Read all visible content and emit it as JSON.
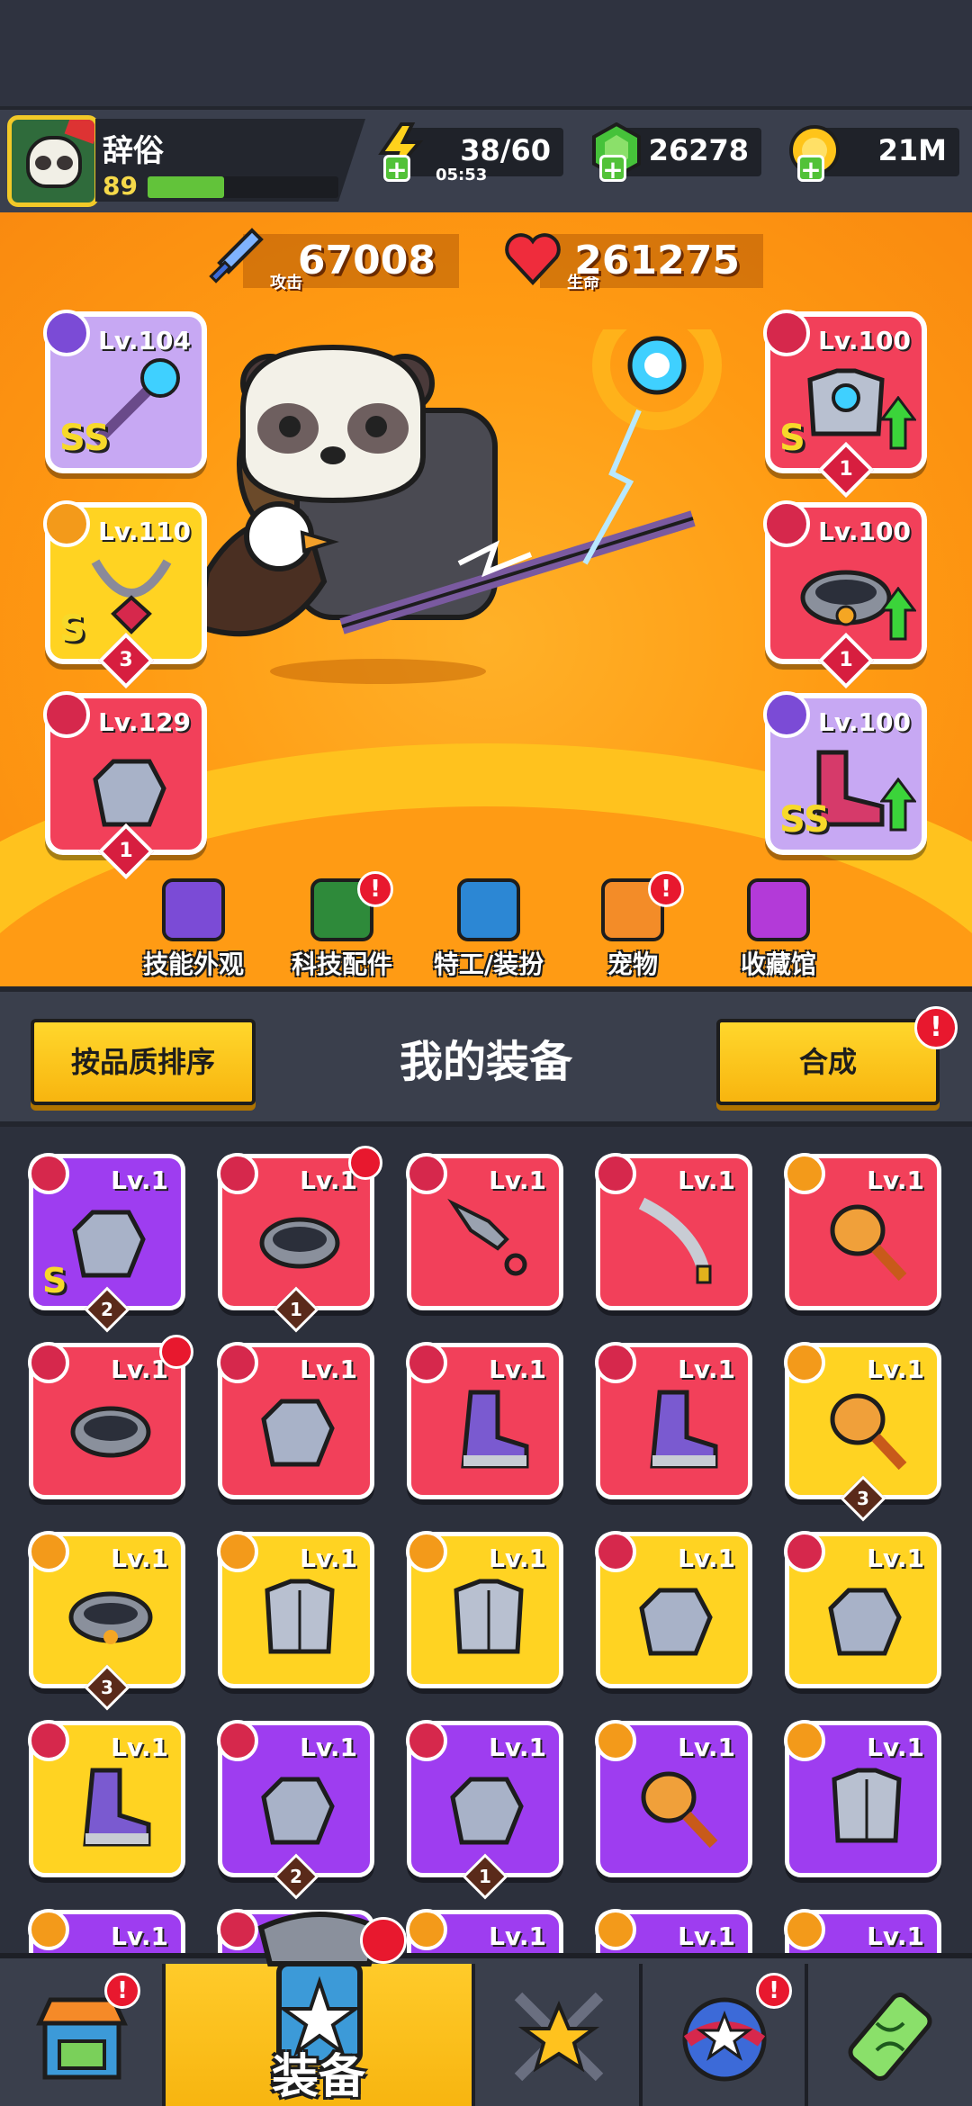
{
  "player": {
    "name": "辞俗",
    "level": "89",
    "xp_fraction": 0.4
  },
  "resources": {
    "energy": {
      "value": "38/60",
      "timer": "05:53",
      "icon": "lightning-icon"
    },
    "gems": {
      "value": "26278",
      "icon": "green-gem-icon"
    },
    "coins": {
      "value": "21M",
      "icon": "gold-coin-icon"
    }
  },
  "stats": {
    "attack": {
      "label": "攻击",
      "value": "67008",
      "icon": "sword-icon"
    },
    "health": {
      "label": "生命",
      "value": "261275",
      "icon": "heart-icon"
    }
  },
  "equipped": {
    "left": [
      {
        "level": "Lv.104",
        "rank": "SS",
        "stars": "",
        "color": "#c7a8f3",
        "item": "staff"
      },
      {
        "level": "Lv.110",
        "rank": "S",
        "stars": "3",
        "color": "#ffd322",
        "item": "necklace"
      },
      {
        "level": "Lv.129",
        "rank": "",
        "stars": "1",
        "color": "#f2405a",
        "item": "glove"
      }
    ],
    "right": [
      {
        "level": "Lv.100",
        "rank": "S",
        "stars": "1",
        "color": "#f2405a",
        "item": "armor",
        "upgrade": true
      },
      {
        "level": "Lv.100",
        "rank": "",
        "stars": "1",
        "color": "#f2405a",
        "item": "belt",
        "upgrade": true
      },
      {
        "level": "Lv.100",
        "rank": "SS",
        "stars": "",
        "color": "#c7a8f3",
        "item": "boots",
        "upgrade": true
      }
    ]
  },
  "shortcuts": [
    {
      "label": "技能外观",
      "alert": false,
      "color": "#7b4bd6"
    },
    {
      "label": "科技配件",
      "alert": true,
      "color": "#2e8a3a"
    },
    {
      "label": "特工/装扮",
      "alert": false,
      "color": "#2c87d4"
    },
    {
      "label": "宠物",
      "alert": true,
      "color": "#f38c28"
    },
    {
      "label": "收藏馆",
      "alert": false,
      "color": "#b33ad8"
    }
  ],
  "equipment_header": {
    "sort_button": "按品质排序",
    "title": "我的装备",
    "merge_button": "合成",
    "merge_alert": "!"
  },
  "inventory": [
    {
      "level": "Lv.1",
      "color": "#9e3df0",
      "rank": "S",
      "count": "2",
      "item": "glove",
      "badge": false
    },
    {
      "level": "Lv.1",
      "color": "#f2405a",
      "rank": "",
      "count": "1",
      "item": "ring",
      "badge": true
    },
    {
      "level": "Lv.1",
      "color": "#f2405a",
      "rank": "",
      "count": "",
      "item": "kunai",
      "badge": false
    },
    {
      "level": "Lv.1",
      "color": "#f2405a",
      "rank": "",
      "count": "",
      "item": "sword",
      "badge": false
    },
    {
      "level": "Lv.1",
      "color": "#f2405a",
      "rank": "",
      "count": "",
      "item": "drill",
      "badge": false
    },
    {
      "level": "Lv.1",
      "color": "#f2405a",
      "rank": "",
      "count": "",
      "item": "ring",
      "badge": true
    },
    {
      "level": "Lv.1",
      "color": "#f2405a",
      "rank": "",
      "count": "",
      "item": "glove",
      "badge": false
    },
    {
      "level": "Lv.1",
      "color": "#f2405a",
      "rank": "",
      "count": "",
      "item": "boots",
      "badge": false
    },
    {
      "level": "Lv.1",
      "color": "#f2405a",
      "rank": "",
      "count": "",
      "item": "boots",
      "badge": false
    },
    {
      "level": "Lv.1",
      "color": "#ffd322",
      "rank": "",
      "count": "3",
      "item": "drill",
      "badge": false
    },
    {
      "level": "Lv.1",
      "color": "#ffd322",
      "rank": "",
      "count": "3",
      "item": "belt",
      "badge": false
    },
    {
      "level": "Lv.1",
      "color": "#ffd322",
      "rank": "",
      "count": "",
      "item": "armor",
      "badge": false
    },
    {
      "level": "Lv.1",
      "color": "#ffd322",
      "rank": "",
      "count": "",
      "item": "armor",
      "badge": false
    },
    {
      "level": "Lv.1",
      "color": "#ffd322",
      "rank": "",
      "count": "",
      "item": "glove",
      "badge": false
    },
    {
      "level": "Lv.1",
      "color": "#ffd322",
      "rank": "",
      "count": "",
      "item": "glove",
      "badge": false
    },
    {
      "level": "Lv.1",
      "color": "#ffd322",
      "rank": "",
      "count": "",
      "item": "boots",
      "badge": false
    },
    {
      "level": "Lv.1",
      "color": "#9e3df0",
      "rank": "",
      "count": "2",
      "item": "glove",
      "badge": false
    },
    {
      "level": "Lv.1",
      "color": "#9e3df0",
      "rank": "",
      "count": "1",
      "item": "glove",
      "badge": false
    },
    {
      "level": "Lv.1",
      "color": "#9e3df0",
      "rank": "",
      "count": "",
      "item": "drill",
      "badge": false
    },
    {
      "level": "Lv.1",
      "color": "#9e3df0",
      "rank": "",
      "count": "",
      "item": "armor",
      "badge": false
    },
    {
      "level": "Lv.1",
      "color": "#9e3df0",
      "rank": "",
      "count": "",
      "item": "armor",
      "badge": false
    },
    {
      "level": "Lv.1",
      "color": "#9e3df0",
      "rank": "",
      "count": "",
      "item": "glove",
      "badge": false
    },
    {
      "level": "Lv.1",
      "color": "#9e3df0",
      "rank": "",
      "count": "",
      "item": "armor",
      "badge": false
    },
    {
      "level": "Lv.1",
      "color": "#9e3df0",
      "rank": "",
      "count": "",
      "item": "armor",
      "badge": false
    },
    {
      "level": "Lv.1",
      "color": "#9e3df0",
      "rank": "",
      "count": "",
      "item": "armor",
      "badge": false
    }
  ],
  "bottom_nav": [
    {
      "id": "shop",
      "label": "",
      "alert": true,
      "icon": "shop-icon"
    },
    {
      "id": "equipment",
      "label": "装备",
      "alert": true,
      "active": true,
      "icon": "equipment-icon"
    },
    {
      "id": "battle",
      "label": "",
      "alert": false,
      "icon": "crossed-swords-star-icon"
    },
    {
      "id": "events",
      "label": "",
      "alert": true,
      "icon": "star-planet-icon"
    },
    {
      "id": "lab",
      "label": "",
      "alert": false,
      "icon": "dna-capsule-icon"
    }
  ]
}
